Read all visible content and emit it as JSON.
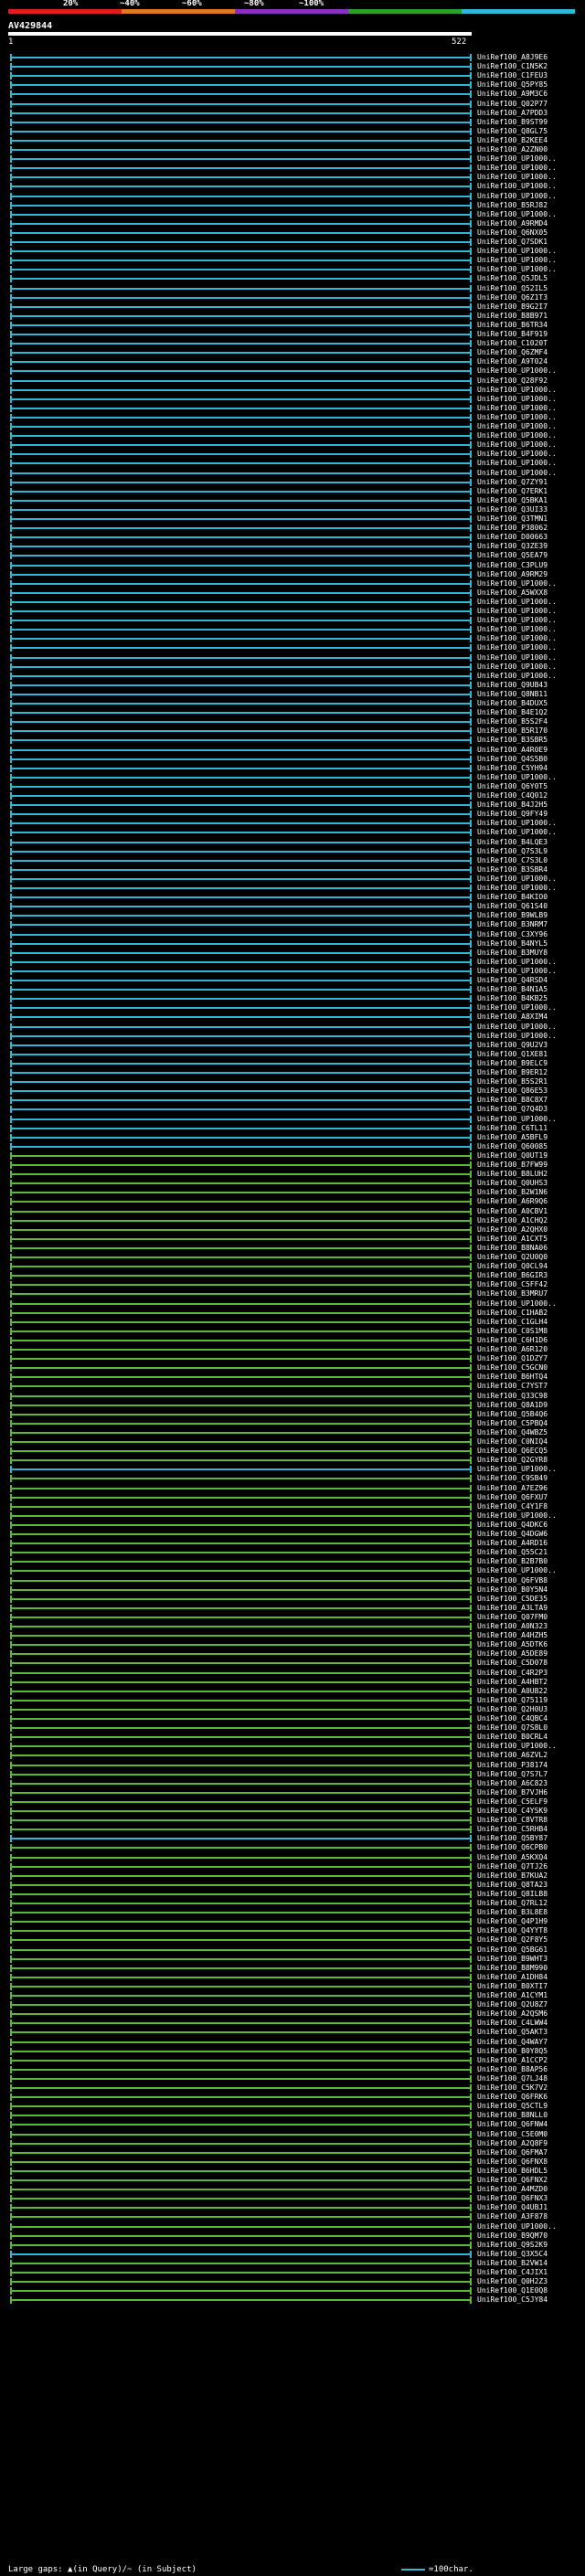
{
  "legend": {
    "labels": [
      "20%",
      "~40%",
      "~60%",
      "~80%",
      "~100%"
    ],
    "colors": [
      "#e01c1c",
      "#e07a1c",
      "#8a2fbf",
      "#2aa02a",
      "#2ab9d6"
    ]
  },
  "title": "AV429844",
  "scale": {
    "start": "1",
    "end": "522"
  },
  "hit_colors": {
    "high": "#2ab9d6",
    "mid": "#5bb832"
  },
  "hits": [
    {
      "name": "UniRef100_A8J9E6",
      "c": "high"
    },
    {
      "name": "UniRef100_C1N5K2",
      "c": "high"
    },
    {
      "name": "UniRef100_C1FEU3",
      "c": "high"
    },
    {
      "name": "UniRef100_Q5PY85",
      "c": "high"
    },
    {
      "name": "UniRef100_A9M3C6",
      "c": "high"
    },
    {
      "name": "UniRef100_Q02P77",
      "c": "high"
    },
    {
      "name": "UniRef100_A7PDD3",
      "c": "high"
    },
    {
      "name": "UniRef100_B9ST99",
      "c": "high"
    },
    {
      "name": "UniRef100_Q8GL75",
      "c": "high"
    },
    {
      "name": "UniRef100_B2KEE4",
      "c": "high"
    },
    {
      "name": "UniRef100_A2ZN00",
      "c": "high"
    },
    {
      "name": "UniRef100_UP1000..",
      "c": "high"
    },
    {
      "name": "UniRef100_UP1000..",
      "c": "high"
    },
    {
      "name": "UniRef100_UP1000..",
      "c": "high"
    },
    {
      "name": "UniRef100_UP1000..",
      "c": "high"
    },
    {
      "name": "UniRef100_UP1000..",
      "c": "high"
    },
    {
      "name": "UniRef100_B5RJ82",
      "c": "high"
    },
    {
      "name": "UniRef100_UP1000..",
      "c": "high"
    },
    {
      "name": "UniRef100_A9RMD4",
      "c": "high"
    },
    {
      "name": "UniRef100_Q6NX05",
      "c": "high"
    },
    {
      "name": "UniRef100_Q7SDK1",
      "c": "high"
    },
    {
      "name": "UniRef100_UP1000..",
      "c": "high"
    },
    {
      "name": "UniRef100_UP1000..",
      "c": "high"
    },
    {
      "name": "UniRef100_UP1000..",
      "c": "high"
    },
    {
      "name": "UniRef100_Q5JDL5",
      "c": "high"
    },
    {
      "name": "UniRef100_Q52IL5",
      "c": "high"
    },
    {
      "name": "UniRef100_Q6Z1T3",
      "c": "high"
    },
    {
      "name": "UniRef100_B9G2I7",
      "c": "high"
    },
    {
      "name": "UniRef100_B8B971",
      "c": "high"
    },
    {
      "name": "UniRef100_B6TR34",
      "c": "high"
    },
    {
      "name": "UniRef100_B4F919",
      "c": "high"
    },
    {
      "name": "UniRef100_C1020T",
      "c": "high"
    },
    {
      "name": "UniRef100_Q6ZMF4",
      "c": "high"
    },
    {
      "name": "UniRef100_A9T024",
      "c": "high"
    },
    {
      "name": "UniRef100_UP1000..",
      "c": "high"
    },
    {
      "name": "UniRef100_Q28F92",
      "c": "high"
    },
    {
      "name": "UniRef100_UP1000..",
      "c": "high"
    },
    {
      "name": "UniRef100_UP1000..",
      "c": "high"
    },
    {
      "name": "UniRef100_UP1000..",
      "c": "high"
    },
    {
      "name": "UniRef100_UP1000..",
      "c": "high"
    },
    {
      "name": "UniRef100_UP1000..",
      "c": "high"
    },
    {
      "name": "UniRef100_UP1000..",
      "c": "high"
    },
    {
      "name": "UniRef100_UP1000..",
      "c": "high"
    },
    {
      "name": "UniRef100_UP1000..",
      "c": "high"
    },
    {
      "name": "UniRef100_UP1000..",
      "c": "high"
    },
    {
      "name": "UniRef100_UP1000..",
      "c": "high"
    },
    {
      "name": "UniRef100_Q7ZY91",
      "c": "high"
    },
    {
      "name": "UniRef100_Q7ERK1",
      "c": "high"
    },
    {
      "name": "UniRef100_Q5BKA1",
      "c": "high"
    },
    {
      "name": "UniRef100_Q3UI33",
      "c": "high"
    },
    {
      "name": "UniRef100_Q3TMN1",
      "c": "high"
    },
    {
      "name": "UniRef100_P38062",
      "c": "high"
    },
    {
      "name": "UniRef100_D00663",
      "c": "high"
    },
    {
      "name": "UniRef100_Q3ZE39",
      "c": "high"
    },
    {
      "name": "UniRef100_Q5EA79",
      "c": "high"
    },
    {
      "name": "UniRef100_C3PLU9",
      "c": "high"
    },
    {
      "name": "UniRef100_A9RM29",
      "c": "high"
    },
    {
      "name": "UniRef100_UP1000..",
      "c": "high"
    },
    {
      "name": "UniRef100_A5WXX8",
      "c": "high"
    },
    {
      "name": "UniRef100_UP1000..",
      "c": "high"
    },
    {
      "name": "UniRef100_UP1000..",
      "c": "high"
    },
    {
      "name": "UniRef100_UP1000..",
      "c": "high"
    },
    {
      "name": "UniRef100_UP1000..",
      "c": "high"
    },
    {
      "name": "UniRef100_UP1000..",
      "c": "high"
    },
    {
      "name": "UniRef100_UP1000..",
      "c": "high"
    },
    {
      "name": "UniRef100_UP1000..",
      "c": "high"
    },
    {
      "name": "UniRef100_UP1000..",
      "c": "high"
    },
    {
      "name": "UniRef100_UP1000..",
      "c": "high"
    },
    {
      "name": "UniRef100_Q9UB43",
      "c": "high"
    },
    {
      "name": "UniRef100_Q8NB11",
      "c": "high"
    },
    {
      "name": "UniRef100_B4DUX5",
      "c": "high"
    },
    {
      "name": "UniRef100_B4E1Q2",
      "c": "high"
    },
    {
      "name": "UniRef100_B5S2F4",
      "c": "high"
    },
    {
      "name": "UniRef100_B5R170",
      "c": "high"
    },
    {
      "name": "UniRef100_B3SBR5",
      "c": "high"
    },
    {
      "name": "UniRef100_A4R0E9",
      "c": "high"
    },
    {
      "name": "UniRef100_Q4S5B0",
      "c": "high"
    },
    {
      "name": "UniRef100_C5YH94",
      "c": "high"
    },
    {
      "name": "UniRef100_UP1000..",
      "c": "high"
    },
    {
      "name": "UniRef100_Q6Y0T5",
      "c": "high"
    },
    {
      "name": "UniRef100_C4Q012",
      "c": "high"
    },
    {
      "name": "UniRef100_B4J2H5",
      "c": "high"
    },
    {
      "name": "UniRef100_Q9FY49",
      "c": "high"
    },
    {
      "name": "UniRef100_UP1000..",
      "c": "high"
    },
    {
      "name": "UniRef100_UP1000..",
      "c": "high"
    },
    {
      "name": "UniRef100_B4LQE3",
      "c": "high"
    },
    {
      "name": "UniRef100_Q7S3L9",
      "c": "high"
    },
    {
      "name": "UniRef100_C7S3L0",
      "c": "high"
    },
    {
      "name": "UniRef100_B3SBR4",
      "c": "high"
    },
    {
      "name": "UniRef100_UP1000..",
      "c": "high"
    },
    {
      "name": "UniRef100_UP1000..",
      "c": "high"
    },
    {
      "name": "UniRef100_B4KIO0",
      "c": "high"
    },
    {
      "name": "UniRef100_Q61S40",
      "c": "high"
    },
    {
      "name": "UniRef100_B9WLB9",
      "c": "high"
    },
    {
      "name": "UniRef100_B3NRM7",
      "c": "high"
    },
    {
      "name": "UniRef100_C3XY96",
      "c": "high"
    },
    {
      "name": "UniRef100_B4NYL5",
      "c": "high"
    },
    {
      "name": "UniRef100_B3MUY8",
      "c": "high"
    },
    {
      "name": "UniRef100_UP1000..",
      "c": "high"
    },
    {
      "name": "UniRef100_UP1000..",
      "c": "high"
    },
    {
      "name": "UniRef100_Q4RSD4",
      "c": "high"
    },
    {
      "name": "UniRef100_B4N1A5",
      "c": "high"
    },
    {
      "name": "UniRef100_B4KB25",
      "c": "high"
    },
    {
      "name": "UniRef100_UP1000..",
      "c": "high"
    },
    {
      "name": "UniRef100_A8XIM4",
      "c": "high"
    },
    {
      "name": "UniRef100_UP1000..",
      "c": "high"
    },
    {
      "name": "UniRef100_UP1000..",
      "c": "high"
    },
    {
      "name": "UniRef100_Q9U2V3",
      "c": "high"
    },
    {
      "name": "UniRef100_Q1XE81",
      "c": "high"
    },
    {
      "name": "UniRef100_B9ELC9",
      "c": "high"
    },
    {
      "name": "UniRef100_B9ER12",
      "c": "high"
    },
    {
      "name": "UniRef100_B5S2R1",
      "c": "high"
    },
    {
      "name": "UniRef100_Q86E53",
      "c": "high"
    },
    {
      "name": "UniRef100_B8C8X7",
      "c": "high"
    },
    {
      "name": "UniRef100_Q7Q4D3",
      "c": "high"
    },
    {
      "name": "UniRef100_UP1000..",
      "c": "high"
    },
    {
      "name": "UniRef100_C6TL11",
      "c": "high"
    },
    {
      "name": "UniRef100_A5BFL9",
      "c": "high"
    },
    {
      "name": "UniRef100_Q60085",
      "c": "high"
    },
    {
      "name": "UniRef100_Q0UT19",
      "c": "mid"
    },
    {
      "name": "UniRef100_B7FW99",
      "c": "mid"
    },
    {
      "name": "UniRef100_B8LUH2",
      "c": "mid"
    },
    {
      "name": "UniRef100_Q0UHS3",
      "c": "mid"
    },
    {
      "name": "UniRef100_B2W1N6",
      "c": "mid"
    },
    {
      "name": "UniRef100_A6R9Q6",
      "c": "mid"
    },
    {
      "name": "UniRef100_A0CBV1",
      "c": "mid"
    },
    {
      "name": "UniRef100_A1CHQ2",
      "c": "mid"
    },
    {
      "name": "UniRef100_A2QHX0",
      "c": "mid"
    },
    {
      "name": "UniRef100_A1CXT5",
      "c": "mid"
    },
    {
      "name": "UniRef100_B8NA06",
      "c": "mid"
    },
    {
      "name": "UniRef100_Q2U0Q0",
      "c": "mid"
    },
    {
      "name": "UniRef100_Q0CL94",
      "c": "mid"
    },
    {
      "name": "UniRef100_B6GIR3",
      "c": "mid"
    },
    {
      "name": "UniRef100_C5FF42",
      "c": "mid"
    },
    {
      "name": "UniRef100_B3MRU7",
      "c": "mid"
    },
    {
      "name": "UniRef100_UP1000..",
      "c": "mid"
    },
    {
      "name": "UniRef100_C1HAB2",
      "c": "mid"
    },
    {
      "name": "UniRef100_C1GLH4",
      "c": "mid"
    },
    {
      "name": "UniRef100_C0S1M8",
      "c": "mid"
    },
    {
      "name": "UniRef100_C6H1D6",
      "c": "mid"
    },
    {
      "name": "UniRef100_A6R120",
      "c": "mid"
    },
    {
      "name": "UniRef100_Q1DZY7",
      "c": "mid"
    },
    {
      "name": "UniRef100_C5GCN0",
      "c": "mid"
    },
    {
      "name": "UniRef100_B6HTQ4",
      "c": "mid"
    },
    {
      "name": "UniRef100_C7YST7",
      "c": "mid"
    },
    {
      "name": "UniRef100_Q33C98",
      "c": "mid"
    },
    {
      "name": "UniRef100_Q8A1D9",
      "c": "mid"
    },
    {
      "name": "UniRef100_Q5B4Q6",
      "c": "mid"
    },
    {
      "name": "UniRef100_C5PBQ4",
      "c": "mid"
    },
    {
      "name": "UniRef100_Q4WBZ5",
      "c": "mid"
    },
    {
      "name": "UniRef100_C0NIQ4",
      "c": "mid"
    },
    {
      "name": "UniRef100_Q6ECQ5",
      "c": "mid"
    },
    {
      "name": "UniRef100_Q2GYR8",
      "c": "mid"
    },
    {
      "name": "UniRef100_UP1000..",
      "c": "high"
    },
    {
      "name": "UniRef100_C9SB49",
      "c": "mid"
    },
    {
      "name": "UniRef100_A7EZ96",
      "c": "mid"
    },
    {
      "name": "UniRef100_Q6FXU7",
      "c": "mid"
    },
    {
      "name": "UniRef100_C4Y1F8",
      "c": "mid"
    },
    {
      "name": "UniRef100_UP1000..",
      "c": "mid"
    },
    {
      "name": "UniRef100_Q4DKC6",
      "c": "mid"
    },
    {
      "name": "UniRef100_Q4DGW6",
      "c": "mid"
    },
    {
      "name": "UniRef100_A4RD16",
      "c": "mid"
    },
    {
      "name": "UniRef100_Q55C21",
      "c": "mid"
    },
    {
      "name": "UniRef100_B2B7B0",
      "c": "mid"
    },
    {
      "name": "UniRef100_UP1000..",
      "c": "mid"
    },
    {
      "name": "UniRef100_Q6FVB8",
      "c": "mid"
    },
    {
      "name": "UniRef100_B0Y5N4",
      "c": "mid"
    },
    {
      "name": "UniRef100_C5DE35",
      "c": "mid"
    },
    {
      "name": "UniRef100_A3LTA9",
      "c": "mid"
    },
    {
      "name": "UniRef100_Q07FM0",
      "c": "mid"
    },
    {
      "name": "UniRef100_A0N323",
      "c": "mid"
    },
    {
      "name": "UniRef100_A4HZH5",
      "c": "mid"
    },
    {
      "name": "UniRef100_A5DTK6",
      "c": "mid"
    },
    {
      "name": "UniRef100_A5DE89",
      "c": "mid"
    },
    {
      "name": "UniRef100_C5D078",
      "c": "mid"
    },
    {
      "name": "UniRef100_C4R2P3",
      "c": "mid"
    },
    {
      "name": "UniRef100_A4HBT2",
      "c": "mid"
    },
    {
      "name": "UniRef100_A0UB22",
      "c": "mid"
    },
    {
      "name": "UniRef100_Q75119",
      "c": "mid"
    },
    {
      "name": "UniRef100_Q2H0U3",
      "c": "mid"
    },
    {
      "name": "UniRef100_C4QBC4",
      "c": "mid"
    },
    {
      "name": "UniRef100_Q7S8L0",
      "c": "mid"
    },
    {
      "name": "UniRef100_B0CRL4",
      "c": "mid"
    },
    {
      "name": "UniRef100_UP1000..",
      "c": "mid"
    },
    {
      "name": "UniRef100_A6ZVL2",
      "c": "mid"
    },
    {
      "name": "UniRef100_P38174",
      "c": "mid"
    },
    {
      "name": "UniRef100_Q7S7L7",
      "c": "mid"
    },
    {
      "name": "UniRef100_A6C823",
      "c": "mid"
    },
    {
      "name": "UniRef100_B7VJH6",
      "c": "mid"
    },
    {
      "name": "UniRef100_C5ELF9",
      "c": "mid"
    },
    {
      "name": "UniRef100_C4YSK9",
      "c": "mid"
    },
    {
      "name": "UniRef100_C8VTR8",
      "c": "mid"
    },
    {
      "name": "UniRef100_C5RHB4",
      "c": "mid"
    },
    {
      "name": "UniRef100_Q5BY87",
      "c": "high"
    },
    {
      "name": "UniRef100_Q6CPB0",
      "c": "mid"
    },
    {
      "name": "UniRef100_A5KXQ4",
      "c": "mid"
    },
    {
      "name": "UniRef100_Q7TJ26",
      "c": "mid"
    },
    {
      "name": "UniRef100_B7KUA2",
      "c": "mid"
    },
    {
      "name": "UniRef100_Q8TA23",
      "c": "mid"
    },
    {
      "name": "UniRef100_Q8ILB8",
      "c": "mid"
    },
    {
      "name": "UniRef100_Q7RL12",
      "c": "mid"
    },
    {
      "name": "UniRef100_B3L8E8",
      "c": "mid"
    },
    {
      "name": "UniRef100_Q4P1H9",
      "c": "mid"
    },
    {
      "name": "UniRef100_Q4YYT8",
      "c": "mid"
    },
    {
      "name": "UniRef100_Q2F8Y5",
      "c": "mid"
    },
    {
      "name": "UniRef100_Q5BG61",
      "c": "mid"
    },
    {
      "name": "UniRef100_B9WHT3",
      "c": "mid"
    },
    {
      "name": "UniRef100_B8M990",
      "c": "mid"
    },
    {
      "name": "UniRef100_A1DH84",
      "c": "mid"
    },
    {
      "name": "UniRef100_B0XTI7",
      "c": "mid"
    },
    {
      "name": "UniRef100_A1CYM1",
      "c": "mid"
    },
    {
      "name": "UniRef100_Q2U8Z7",
      "c": "mid"
    },
    {
      "name": "UniRef100_A2QSM6",
      "c": "mid"
    },
    {
      "name": "UniRef100_C4LWW4",
      "c": "mid"
    },
    {
      "name": "UniRef100_Q5AKT3",
      "c": "mid"
    },
    {
      "name": "UniRef100_Q4WAY7",
      "c": "mid"
    },
    {
      "name": "UniRef100_B0Y8Q5",
      "c": "mid"
    },
    {
      "name": "UniRef100_A1CCP2",
      "c": "mid"
    },
    {
      "name": "UniRef100_B8AP56",
      "c": "mid"
    },
    {
      "name": "UniRef100_Q7LJ48",
      "c": "mid"
    },
    {
      "name": "UniRef100_C5K7V2",
      "c": "mid"
    },
    {
      "name": "UniRef100_Q6FRK6",
      "c": "mid"
    },
    {
      "name": "UniRef100_Q5CTL9",
      "c": "mid"
    },
    {
      "name": "UniRef100_B8NLL0",
      "c": "mid"
    },
    {
      "name": "UniRef100_Q6FNW4",
      "c": "mid"
    },
    {
      "name": "UniRef100_C5E0M0",
      "c": "mid"
    },
    {
      "name": "UniRef100_A2Q8F9",
      "c": "mid"
    },
    {
      "name": "UniRef100_Q6FMA7",
      "c": "mid"
    },
    {
      "name": "UniRef100_Q6FNX8",
      "c": "mid"
    },
    {
      "name": "UniRef100_B6HDL5",
      "c": "mid"
    },
    {
      "name": "UniRef100_Q6FNX2",
      "c": "mid"
    },
    {
      "name": "UniRef100_A4MZD0",
      "c": "mid"
    },
    {
      "name": "UniRef100_Q6FNX3",
      "c": "mid"
    },
    {
      "name": "UniRef100_Q4UBJ1",
      "c": "mid"
    },
    {
      "name": "UniRef100_A3F878",
      "c": "mid"
    },
    {
      "name": "UniRef100_UP1000..",
      "c": "mid"
    },
    {
      "name": "UniRef100_B9QM70",
      "c": "mid"
    },
    {
      "name": "UniRef100_Q9S2K9",
      "c": "mid"
    },
    {
      "name": "UniRef100_Q3X5C4",
      "c": "high"
    },
    {
      "name": "UniRef100_B2VW14",
      "c": "mid"
    },
    {
      "name": "UniRef100_C4JIX1",
      "c": "mid"
    },
    {
      "name": "UniRef100_Q0H2Z3",
      "c": "mid"
    },
    {
      "name": "UniRef100_Q1E0Q8",
      "c": "mid"
    },
    {
      "name": "UniRef100_C5JY84",
      "c": "mid"
    }
  ],
  "footer": {
    "left": "Large gaps: ▲(in Query)/~ (in Subject)",
    "scale_text": "=100char."
  }
}
